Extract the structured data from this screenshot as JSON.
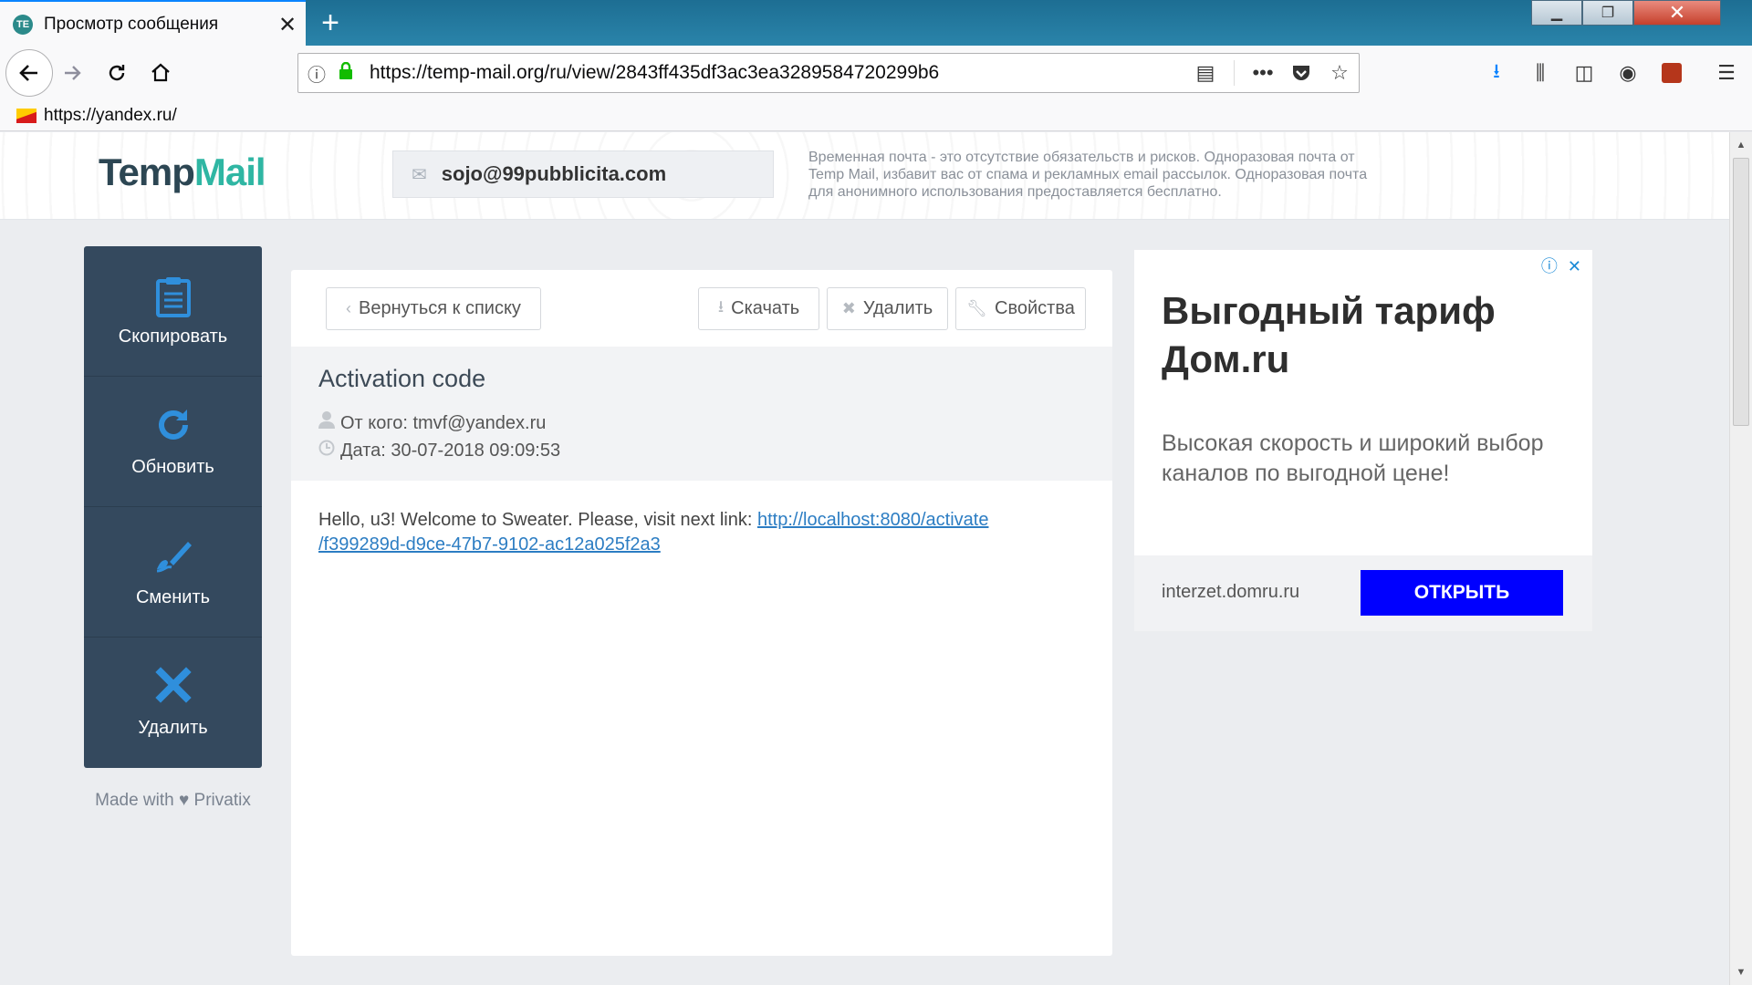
{
  "browser": {
    "tab_title": "Просмотр сообщения",
    "tab_favicon_text": "TE",
    "tab_close": "✕",
    "new_tab": "+",
    "url": "https://temp-mail.org/ru/view/2843ff435df3ac3ea3289584720299b6",
    "bookmark": "https://yandex.ru/"
  },
  "header": {
    "logo_temp": "Temp",
    "logo_mail": "Mail",
    "email": "sojo@99pubblicita.com",
    "description": "Временная почта - это отсутствие обязательств и рисков. Одноразовая почта от Temp Mail, избавит вас от спама и рекламных email рассылок. Одноразовая почта для анонимного использования предоставляется бесплатно."
  },
  "sidebar": {
    "items": [
      {
        "label": "Скопировать",
        "icon": "clipboard-icon"
      },
      {
        "label": "Обновить",
        "icon": "refresh-icon"
      },
      {
        "label": "Сменить",
        "icon": "edit-icon"
      },
      {
        "label": "Удалить",
        "icon": "delete-icon"
      }
    ],
    "footer": "Made with ♥ Privatix"
  },
  "message": {
    "back_label": "Вернуться к списку",
    "download_label": "Скачать",
    "delete_label": "Удалить",
    "properties_label": "Свойства",
    "subject": "Activation code",
    "from": "От кого: tmvf@yandex.ru",
    "date": "Дата: 30-07-2018 09:09:53",
    "body_text": "Hello, u3! Welcome to Sweater. Please, visit next link: ",
    "link_line1": "http://localhost:8080/activate",
    "link_line2": "/f399289d-d9ce-47b7-9102-ac12a025f2a3"
  },
  "ad": {
    "title": "Выгодный тариф Дом.ru",
    "subtitle": "Высокая скорость и широкий выбор каналов по выгодной цене!",
    "domain": "interzet.domru.ru",
    "button": "ОТКРЫТЬ",
    "button_color": "#0000ff"
  },
  "colors": {
    "sidebar_bg": "#34495e",
    "accent_blue": "#2f8fdc",
    "logo_teal": "#2fb6a3"
  }
}
